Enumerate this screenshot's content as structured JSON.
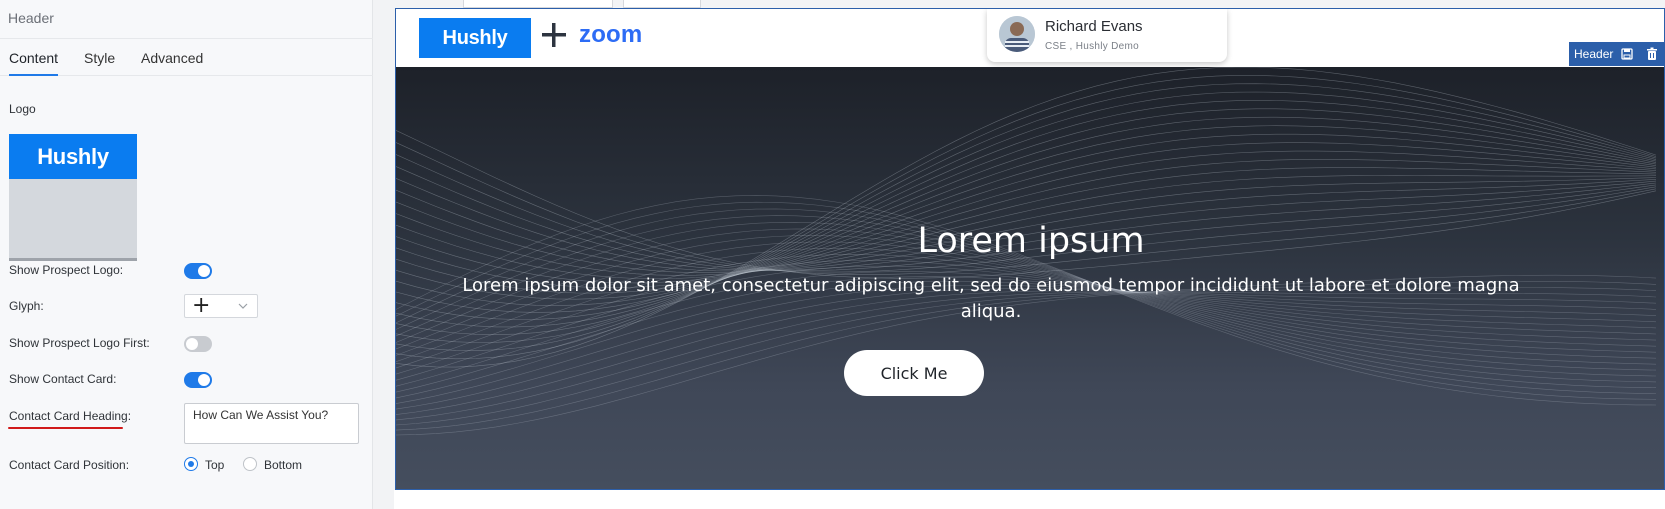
{
  "panel": {
    "title": "Header",
    "tabs": [
      {
        "label": "Content",
        "active": true
      },
      {
        "label": "Style",
        "active": false
      },
      {
        "label": "Advanced",
        "active": false
      }
    ],
    "logo_label": "Logo",
    "logo_text": "Hushly",
    "fields": {
      "show_prospect_logo": {
        "label": "Show Prospect Logo",
        "value": true
      },
      "glyph": {
        "label": "Glyph",
        "value": "+"
      },
      "show_prospect_logo_first": {
        "label": "Show Prospect Logo First",
        "value": false
      },
      "show_contact_card": {
        "label": "Show Contact Card",
        "value": true
      },
      "contact_card_heading": {
        "label": "Contact Card Heading",
        "value": "How Can We Assist You?"
      },
      "contact_card_position": {
        "label": "Contact Card Position",
        "options": [
          "Top",
          "Bottom"
        ],
        "selected": "Top"
      }
    },
    "colon": ":"
  },
  "preview": {
    "brand_logo": "Hushly",
    "partner_logo": "zoom",
    "contact_card": {
      "name": "Richard Evans",
      "subtitle": "CSE , Hushly Demo"
    },
    "edit_bar": {
      "label": "Header",
      "save_icon": "save-icon",
      "delete_icon": "trash-icon"
    },
    "hero": {
      "title": "Lorem ipsum",
      "text": "Lorem ipsum dolor sit amet, consectetur adipiscing elit, sed do eiusmod tempor incididunt ut labore et dolore magna aliqua.",
      "button": "Click Me"
    }
  },
  "colors": {
    "accent": "#1f7ae8",
    "brand_blue": "#0a7cf0",
    "zoom_blue": "#2d6cf5",
    "edit_bar": "#2c5faa",
    "annotation_red": "#d11a1a"
  }
}
